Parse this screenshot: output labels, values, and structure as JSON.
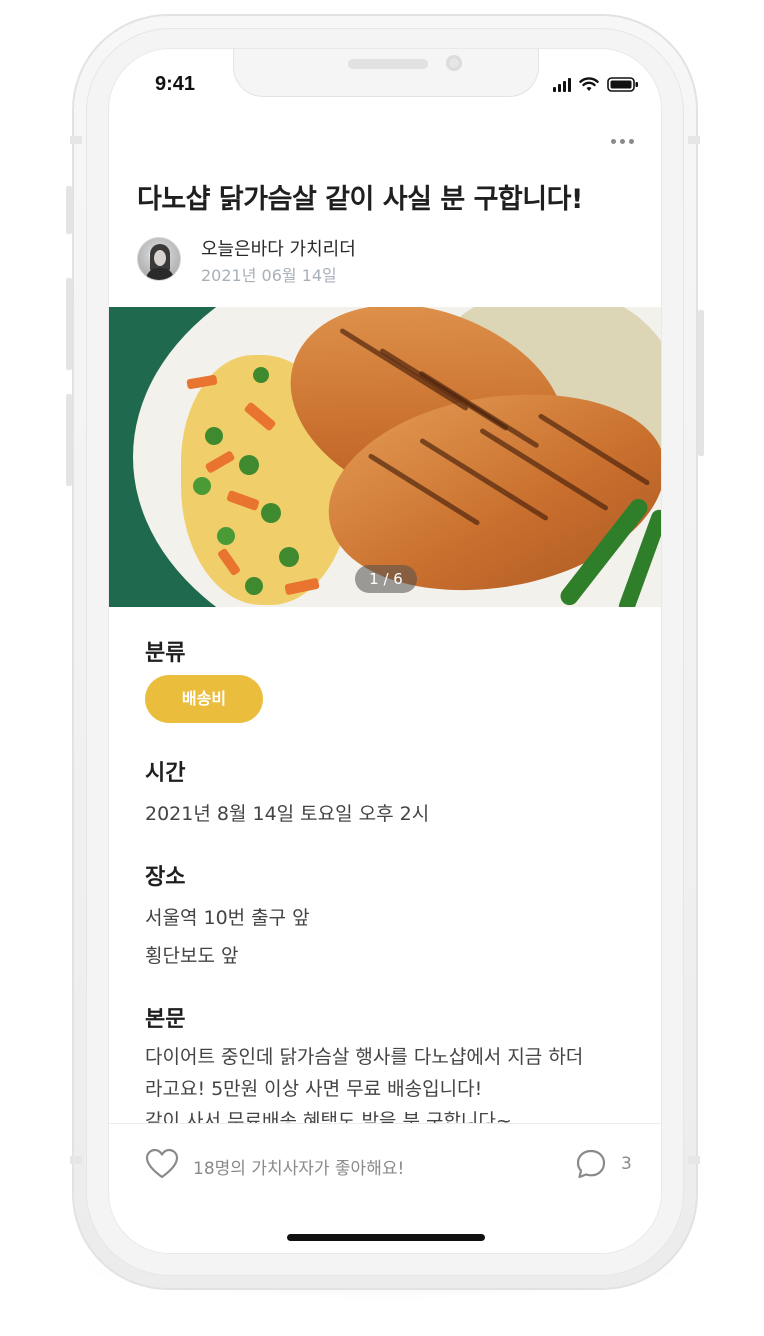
{
  "status_bar": {
    "time": "9:41"
  },
  "post": {
    "title": "다노샵 닭가슴살 같이 사실 분 구합니다!",
    "author": "오늘은바다 가치리더",
    "date": "2021년 06월 14일",
    "image_pager": "1 / 6"
  },
  "sections": {
    "category": {
      "label": "분류",
      "value": "배송비"
    },
    "time": {
      "label": "시간",
      "value": "2021년 8월 14일 토요일 오후 2시"
    },
    "place": {
      "label": "장소",
      "lines": [
        "서울역 10번 출구 앞",
        "횡단보도 앞"
      ]
    },
    "body": {
      "label": "본문",
      "lines": [
        "다이어트 중인데 닭가슴살 행사를 다노샵에서 지금 하더",
        "라고요! 5만원 이상 사면 무료 배송입니다!",
        "같이 사서 무료배송 혜택도 받을 분 구합니다~"
      ]
    }
  },
  "footer": {
    "likes_text": "18명의 가치사자가 좋아해요!",
    "comment_count": "3"
  },
  "icons": [
    "signal-icon",
    "wifi-icon",
    "battery-icon",
    "more-icon",
    "heart-icon",
    "comment-icon"
  ],
  "colors": {
    "accent": "#EBBD3D",
    "date": "#A8B0B8",
    "muted": "#8A8A8A"
  }
}
